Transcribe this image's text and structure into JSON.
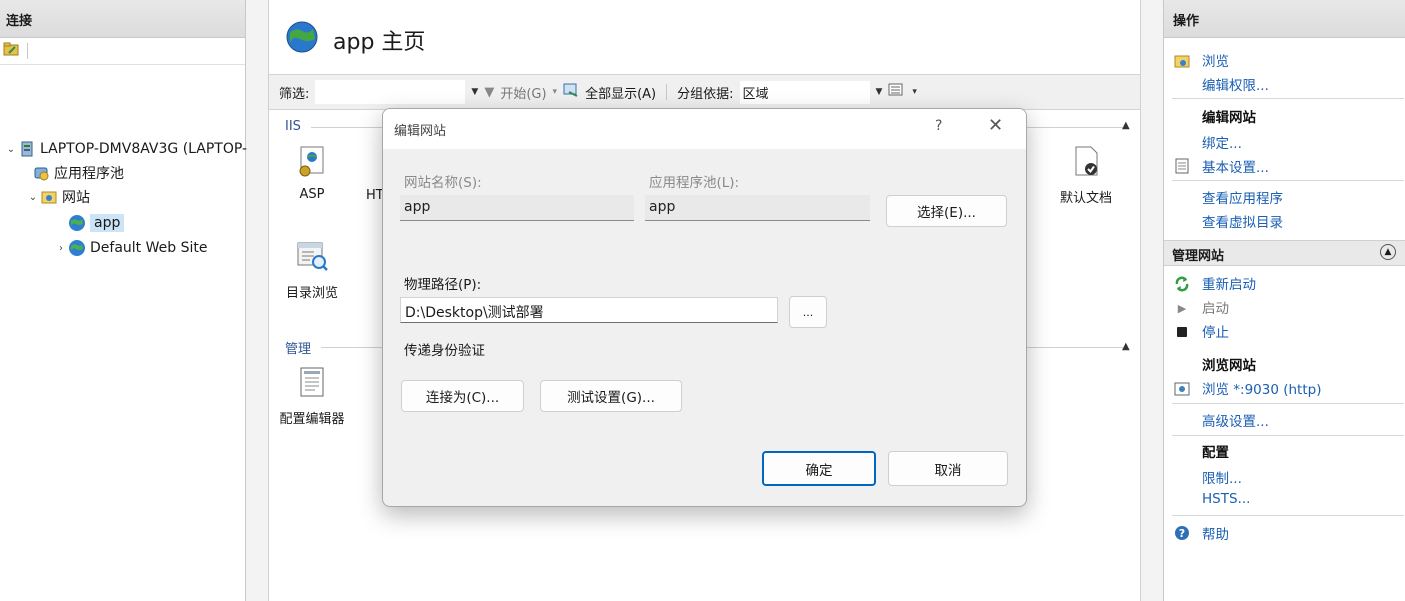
{
  "connections": {
    "header": "连接",
    "tree": [
      {
        "label": "LAPTOP-DMV8AV3G (LAPTOP-",
        "chevron": "⌄"
      },
      {
        "label": "应用程序池"
      },
      {
        "label": "网站",
        "chevron": "⌄"
      },
      {
        "label": "app"
      },
      {
        "label": "Default Web Site",
        "chevron": "›"
      }
    ]
  },
  "home": {
    "title": "app 主页"
  },
  "filterbar": {
    "filter_label": "筛选:",
    "go_label": "开始(G)",
    "show_all_label": "全部显示(A)",
    "group_by_label": "分组依据:",
    "group_by_value": "区域"
  },
  "groups": {
    "iis": "IIS",
    "management": "管理"
  },
  "features": {
    "asp": "ASP",
    "http_partial": "HT",
    "default_doc": "默认文档",
    "dir_browse": "目录浏览",
    "config_editor": "配置编辑器"
  },
  "actions": {
    "header": "操作",
    "browse": "浏览",
    "edit_permissions": "编辑权限...",
    "edit_site_head": "编辑网站",
    "bindings": "绑定...",
    "basic_settings": "基本设置...",
    "view_apps": "查看应用程序",
    "view_vdirs": "查看虚拟目录",
    "manage_site_head": "管理网站",
    "restart": "重新启动",
    "start": "启动",
    "stop": "停止",
    "browse_site_head": "浏览网站",
    "browse_port": "浏览 *:9030 (http)",
    "advanced_settings": "高级设置...",
    "config_head": "配置",
    "limits": "限制...",
    "hsts": "HSTS...",
    "help": "帮助"
  },
  "dialog": {
    "title": "编辑网站",
    "help": "?",
    "close": "✕",
    "site_name_label": "网站名称(S):",
    "site_name_value": "app",
    "app_pool_label": "应用程序池(L):",
    "app_pool_value": "app",
    "select_button": "选择(E)...",
    "physical_path_label": "物理路径(P):",
    "physical_path_value": "D:\\Desktop\\测试部署",
    "browse_button": "...",
    "passthrough_label": "传递身份验证",
    "connect_as_button": "连接为(C)...",
    "test_settings_button": "测试设置(G)...",
    "ok_button": "确定",
    "cancel_button": "取消"
  },
  "colors": {
    "link": "#1a5fb4",
    "accent": "#0067c0",
    "selection": "#cce4f7"
  }
}
